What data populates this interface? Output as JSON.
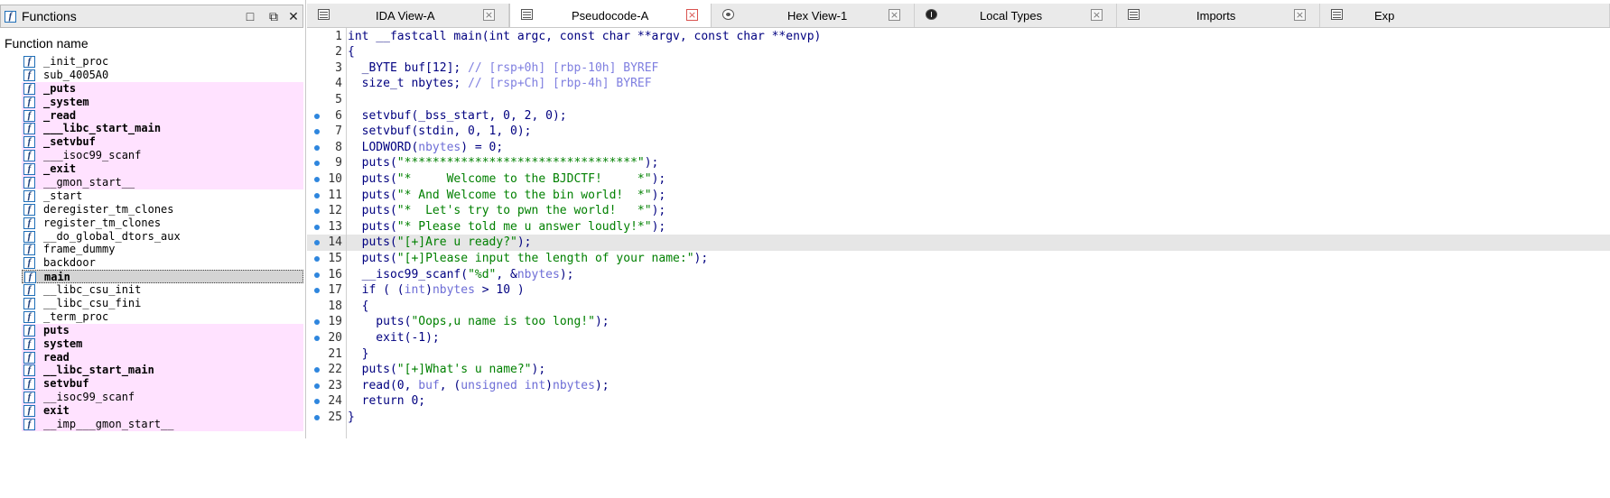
{
  "functions_panel": {
    "title": "Functions",
    "column_header": "Function name",
    "items": [
      {
        "name": "_init_proc",
        "style": "normal"
      },
      {
        "name": "sub_4005A0",
        "style": "normal"
      },
      {
        "name": "_puts",
        "style": "pink-bold"
      },
      {
        "name": "_system",
        "style": "pink-bold"
      },
      {
        "name": "_read",
        "style": "pink-bold"
      },
      {
        "name": "___libc_start_main",
        "style": "pink-bold"
      },
      {
        "name": "_setvbuf",
        "style": "pink-bold"
      },
      {
        "name": "___isoc99_scanf",
        "style": "pink"
      },
      {
        "name": "_exit",
        "style": "pink-bold"
      },
      {
        "name": "__gmon_start__",
        "style": "pink"
      },
      {
        "name": "_start",
        "style": "normal"
      },
      {
        "name": "deregister_tm_clones",
        "style": "normal"
      },
      {
        "name": "register_tm_clones",
        "style": "normal"
      },
      {
        "name": "__do_global_dtors_aux",
        "style": "normal"
      },
      {
        "name": "frame_dummy",
        "style": "normal"
      },
      {
        "name": "backdoor",
        "style": "normal"
      },
      {
        "name": "main",
        "style": "selected-bold"
      },
      {
        "name": "__libc_csu_init",
        "style": "normal"
      },
      {
        "name": "__libc_csu_fini",
        "style": "normal"
      },
      {
        "name": "_term_proc",
        "style": "normal"
      },
      {
        "name": "puts",
        "style": "pink-bold"
      },
      {
        "name": "system",
        "style": "pink-bold"
      },
      {
        "name": "read",
        "style": "pink-bold"
      },
      {
        "name": "__libc_start_main",
        "style": "pink-bold"
      },
      {
        "name": "setvbuf",
        "style": "pink-bold"
      },
      {
        "name": "__isoc99_scanf",
        "style": "pink"
      },
      {
        "name": "exit",
        "style": "pink-bold"
      },
      {
        "name": "__imp___gmon_start__",
        "style": "pink"
      }
    ]
  },
  "tabs": [
    {
      "label": "IDA View-A",
      "icon": "listing-icon",
      "active": false
    },
    {
      "label": "Pseudocode-A",
      "icon": "listing-icon",
      "active": true
    },
    {
      "label": "Hex View-1",
      "icon": "hex-icon",
      "active": false
    },
    {
      "label": "Local Types",
      "icon": "types-icon",
      "active": false
    },
    {
      "label": "Imports",
      "icon": "imports-icon",
      "active": false
    },
    {
      "label": "Exp",
      "icon": "exports-icon",
      "active": false
    }
  ],
  "code": {
    "highlighted_line": 14,
    "lines": [
      {
        "n": "1",
        "bp": false,
        "segs": [
          [
            "kw",
            "int __fastcall main(int argc, const char **argv, const char **envp)"
          ]
        ]
      },
      {
        "n": "2",
        "bp": false,
        "segs": [
          [
            "kw",
            "{"
          ]
        ]
      },
      {
        "n": "3",
        "bp": false,
        "segs": [
          [
            "kw",
            "  _BYTE buf[12]; "
          ],
          [
            "cm",
            "// [rsp+0h] [rbp-10h] BYREF"
          ]
        ]
      },
      {
        "n": "4",
        "bp": false,
        "segs": [
          [
            "kw",
            "  size_t nbytes; "
          ],
          [
            "cm",
            "// [rsp+Ch] [rbp-4h] BYREF"
          ]
        ]
      },
      {
        "n": "5",
        "bp": false,
        "segs": [
          [
            "kw",
            ""
          ]
        ]
      },
      {
        "n": "6",
        "bp": true,
        "segs": [
          [
            "kw",
            "  setvbuf(_bss_start, 0, 2, 0);"
          ]
        ]
      },
      {
        "n": "7",
        "bp": true,
        "segs": [
          [
            "kw",
            "  setvbuf(stdin, 0, 1, 0);"
          ]
        ]
      },
      {
        "n": "8",
        "bp": true,
        "segs": [
          [
            "kw",
            "  LODWORD("
          ],
          [
            "var",
            "nbytes"
          ],
          [
            "kw",
            ") = 0;"
          ]
        ]
      },
      {
        "n": "9",
        "bp": true,
        "segs": [
          [
            "kw",
            "  puts("
          ],
          [
            "str",
            "\"*********************************\""
          ],
          [
            "kw",
            ");"
          ]
        ]
      },
      {
        "n": "10",
        "bp": true,
        "segs": [
          [
            "kw",
            "  puts("
          ],
          [
            "str",
            "\"*     Welcome to the BJDCTF!     *\""
          ],
          [
            "kw",
            ");"
          ]
        ]
      },
      {
        "n": "11",
        "bp": true,
        "segs": [
          [
            "kw",
            "  puts("
          ],
          [
            "str",
            "\"* And Welcome to the bin world!  *\""
          ],
          [
            "kw",
            ");"
          ]
        ]
      },
      {
        "n": "12",
        "bp": true,
        "segs": [
          [
            "kw",
            "  puts("
          ],
          [
            "str",
            "\"*  Let's try to pwn the world!   *\""
          ],
          [
            "kw",
            ");"
          ]
        ]
      },
      {
        "n": "13",
        "bp": true,
        "segs": [
          [
            "kw",
            "  puts("
          ],
          [
            "str",
            "\"* Please told me u answer loudly!*\""
          ],
          [
            "kw",
            ");"
          ]
        ]
      },
      {
        "n": "14",
        "bp": true,
        "segs": [
          [
            "kw",
            "  puts("
          ],
          [
            "str",
            "\"[+]Are u ready?\""
          ],
          [
            "kw",
            ");"
          ]
        ]
      },
      {
        "n": "15",
        "bp": true,
        "segs": [
          [
            "kw",
            "  puts("
          ],
          [
            "str",
            "\"[+]Please input the length of your name:\""
          ],
          [
            "kw",
            ");"
          ]
        ]
      },
      {
        "n": "16",
        "bp": true,
        "segs": [
          [
            "kw",
            "  __isoc99_scanf("
          ],
          [
            "str",
            "\"%d\""
          ],
          [
            "kw",
            ", &"
          ],
          [
            "var",
            "nbytes"
          ],
          [
            "kw",
            ");"
          ]
        ]
      },
      {
        "n": "17",
        "bp": true,
        "segs": [
          [
            "kw",
            "  if ( ("
          ],
          [
            "var",
            "int"
          ],
          [
            "kw",
            ")"
          ],
          [
            "var",
            "nbytes"
          ],
          [
            "kw",
            " > 10 )"
          ]
        ]
      },
      {
        "n": "18",
        "bp": false,
        "segs": [
          [
            "kw",
            "  {"
          ]
        ]
      },
      {
        "n": "19",
        "bp": true,
        "segs": [
          [
            "kw",
            "    puts("
          ],
          [
            "str",
            "\"Oops,u name is too long!\""
          ],
          [
            "kw",
            ");"
          ]
        ]
      },
      {
        "n": "20",
        "bp": true,
        "segs": [
          [
            "kw",
            "    exit(-1);"
          ]
        ]
      },
      {
        "n": "21",
        "bp": false,
        "segs": [
          [
            "kw",
            "  }"
          ]
        ]
      },
      {
        "n": "22",
        "bp": true,
        "segs": [
          [
            "kw",
            "  puts("
          ],
          [
            "str",
            "\"[+]What's u name?\""
          ],
          [
            "kw",
            ");"
          ]
        ]
      },
      {
        "n": "23",
        "bp": true,
        "segs": [
          [
            "kw",
            "  read(0, "
          ],
          [
            "var",
            "buf"
          ],
          [
            "kw",
            ", ("
          ],
          [
            "var",
            "unsigned int"
          ],
          [
            "kw",
            ")"
          ],
          [
            "var",
            "nbytes"
          ],
          [
            "kw",
            ");"
          ]
        ]
      },
      {
        "n": "24",
        "bp": true,
        "segs": [
          [
            "kw",
            "  return 0;"
          ]
        ]
      },
      {
        "n": "25",
        "bp": true,
        "segs": [
          [
            "kw",
            "}"
          ]
        ]
      }
    ]
  },
  "colors": {
    "keyword": "#000080",
    "comment": "#7f7fe0",
    "string": "#008000",
    "variable": "#6d6dd6",
    "pink_row": "#ffe2ff",
    "highlight": "#e6e6e6",
    "breakpoint": "#2e86de"
  }
}
